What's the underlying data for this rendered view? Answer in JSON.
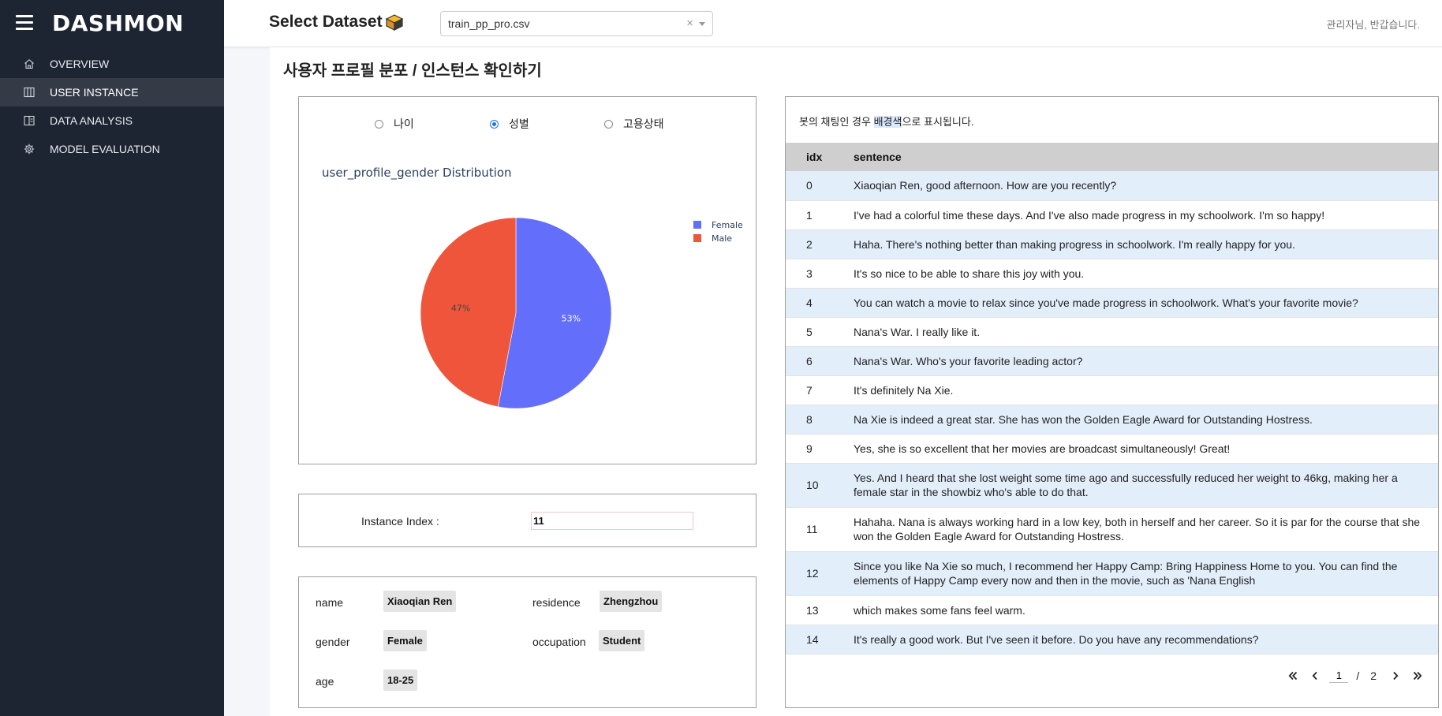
{
  "sidebar": {
    "brand": "DASHMON",
    "items": [
      {
        "label": "OVERVIEW",
        "icon": "home-icon",
        "active": false
      },
      {
        "label": "USER INSTANCE",
        "icon": "columns-icon",
        "active": true
      },
      {
        "label": "DATA ANALYSIS",
        "icon": "book-icon",
        "active": false
      },
      {
        "label": "MODEL EVALUATION",
        "icon": "gear-icon",
        "active": false
      }
    ]
  },
  "header": {
    "title": "Select Dataset",
    "dataset_value": "train_pp_pro.csv",
    "clear_glyph": "×",
    "greeting": "관리자님, 반갑습니다."
  },
  "main": {
    "heading": "사용자 프로필 분포 / 인스턴스 확인하기",
    "radios": [
      {
        "label": "나이",
        "checked": false
      },
      {
        "label": "성별",
        "checked": true
      },
      {
        "label": "고용상태",
        "checked": false
      }
    ]
  },
  "chart_data": {
    "type": "pie",
    "title": "user_profile_gender Distribution",
    "labels": [
      "Female",
      "Male"
    ],
    "values": [
      53,
      47
    ],
    "value_labels": [
      "53%",
      "47%"
    ],
    "colors": [
      "#636efa",
      "#ef553b"
    ],
    "legend_position": "top-right"
  },
  "instance": {
    "label": "Instance Index :",
    "value": "11"
  },
  "profile": {
    "name_label": "name",
    "name": "Xiaoqian Ren",
    "residence_label": "residence",
    "residence": "Zhengzhou",
    "gender_label": "gender",
    "gender": "Female",
    "occupation_label": "occupation",
    "occupation": "Student",
    "age_label": "age",
    "age": "18-25"
  },
  "table": {
    "note_before": "봇의 채팅인 경우 ",
    "note_highlight": "배경색",
    "note_after": "으로 표시됩니다.",
    "headers": [
      "idx",
      "sentence"
    ],
    "rows": [
      {
        "idx": "0",
        "sentence": "Xiaoqian Ren, good afternoon. How are you recently?",
        "bot": true
      },
      {
        "idx": "1",
        "sentence": "I've had a colorful time these days. And I've also made progress in my schoolwork. I'm so happy!",
        "bot": false
      },
      {
        "idx": "2",
        "sentence": "Haha. There's nothing better than making progress in schoolwork. I'm really happy for you.",
        "bot": true
      },
      {
        "idx": "3",
        "sentence": "It's so nice to be able to share this joy with you.",
        "bot": false
      },
      {
        "idx": "4",
        "sentence": "You can watch a movie to relax since you've made progress in schoolwork. What's your favorite movie?",
        "bot": true
      },
      {
        "idx": "5",
        "sentence": "Nana's War. I really like it.",
        "bot": false
      },
      {
        "idx": "6",
        "sentence": "Nana's War. Who's your favorite leading actor?",
        "bot": true
      },
      {
        "idx": "7",
        "sentence": "It's definitely Na Xie.",
        "bot": false
      },
      {
        "idx": "8",
        "sentence": "Na Xie is indeed a great star. She has won the Golden Eagle Award for Outstanding Hostress.",
        "bot": true
      },
      {
        "idx": "9",
        "sentence": "Yes, she is so excellent that her movies are broadcast simultaneously! Great!",
        "bot": false
      },
      {
        "idx": "10",
        "sentence": "Yes. And I heard that she lost weight some time ago and successfully reduced her weight to 46kg, making her a female star in the showbiz who's able to do that.",
        "bot": true
      },
      {
        "idx": "11",
        "sentence": "Hahaha. Nana is always working hard in a low key, both in herself and her career. So it is par for the course that she won the Golden Eagle Award for Outstanding Hostress.",
        "bot": false
      },
      {
        "idx": "12",
        "sentence": "Since you like Na Xie so much, I recommend her Happy Camp: Bring Happiness Home to you. You can find the elements of Happy Camp every now and then in the movie, such as 'Nana English",
        "bot": true
      },
      {
        "idx": "13",
        "sentence": "which makes some fans feel warm.",
        "bot": false
      },
      {
        "idx": "14",
        "sentence": "It's really a good work. But I've seen it before. Do you have any recommendations?",
        "bot": true
      }
    ],
    "pager": {
      "current": "1",
      "separator": "/",
      "total": "2"
    }
  }
}
